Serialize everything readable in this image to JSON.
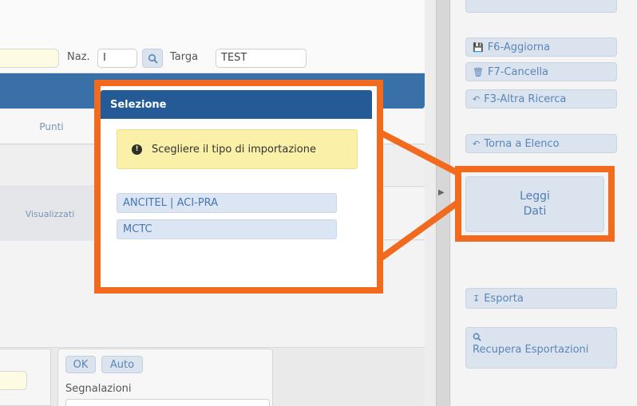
{
  "form": {
    "naz_label": "Naz.",
    "naz_value": "I",
    "targa_label": "Targa",
    "targa_value": "TEST",
    "punti_label": "Punti",
    "visualizzati_label": "Visualizzati",
    "ok_label": "OK",
    "auto_label": "Auto",
    "segnalazioni_label": "Segnalazioni"
  },
  "actions": {
    "aggiorna": "F6-Aggiorna",
    "cancella": "F7-Cancella",
    "altra_ricerca": "F3-Altra Ricerca",
    "torna_elenco": "Torna a Elenco",
    "leggi_line1": "Leggi",
    "leggi_line2": "Dati",
    "esporta": "Esporta",
    "recupera": "Recupera Esportazioni"
  },
  "dialog": {
    "title": "Selezione",
    "message": "Scegliere il tipo di importazione",
    "options": [
      "ANCITEL | ACI-PRA",
      "MCTC"
    ]
  },
  "colors": {
    "highlight": "#f16a1d",
    "dialog_header": "#245b97",
    "alert_bg": "#fbf0a8",
    "button_bg": "#dbe3ee"
  },
  "icons": {
    "save": "floppy-icon",
    "delete": "trash-icon",
    "back": "back-arrow-icon",
    "export": "export-icon",
    "search": "search-icon",
    "alert": "exclamation-circle-icon"
  }
}
